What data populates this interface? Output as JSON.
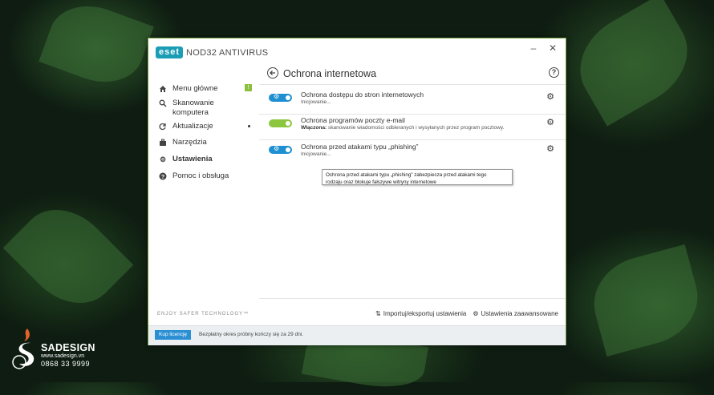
{
  "app": {
    "logo_badge": "eset",
    "product_name": "NOD32 ANTIVIRUS",
    "window_controls": {
      "minimize": "–",
      "close": "✕"
    }
  },
  "sidebar": {
    "items": [
      {
        "label": "Menu główne",
        "icon": "home-icon",
        "badge": "!"
      },
      {
        "label": "Skanowanie komputera",
        "icon": "search-icon"
      },
      {
        "label": "Aktualizacje",
        "icon": "refresh-icon",
        "has_dot": true
      },
      {
        "label": "Narzędzia",
        "icon": "briefcase-icon"
      },
      {
        "label": "Ustawienia",
        "icon": "gear-icon",
        "active": true
      },
      {
        "label": "Pomoc i obsługa",
        "icon": "help-icon"
      }
    ],
    "tagline": "ENJOY SAFER TECHNOLOGY™"
  },
  "content": {
    "title": "Ochrona internetowa",
    "rows": [
      {
        "title": "Ochrona dostępu do stron internetowych",
        "status_label": "",
        "status_text": "Inicjowanie...",
        "toggle_state": "initializing",
        "toggle_color": "#1e8fd0"
      },
      {
        "title": "Ochrona programów poczty e-mail",
        "status_label": "Włączona:",
        "status_text": " skanowanie wiadomości odbieranych i wysyłanych przez program pocztowy.",
        "toggle_state": "on",
        "toggle_color": "#8cc63f"
      },
      {
        "title": "Ochrona przed atakami typu „phishing”",
        "status_label": "",
        "status_text": "Inicjowanie...",
        "toggle_state": "initializing",
        "toggle_color": "#1e8fd0"
      }
    ],
    "tooltip_line1": "Ochrona przed atakami typu „phishing” zabezpiecza przed atakami tego",
    "tooltip_line2": "rodzaju oraz blokuje fałszywe witryny internetowe"
  },
  "footer": {
    "import_export": "Importuj/eksportuj ustawienia",
    "advanced_settings": "Ustawienia zaawansowane"
  },
  "statusbar": {
    "buy_button": "Kup licencję",
    "trial_text": "Bezpłatny okres próbny kończy się za 29 dni."
  },
  "watermark": {
    "brand": "SADESIGN",
    "url": "www.sadesign.vn",
    "phone": "0868 33 9999"
  },
  "colors": {
    "accent_blue": "#1e8fd0",
    "accent_green": "#8cc63f",
    "window_border": "#6e9e3a"
  }
}
